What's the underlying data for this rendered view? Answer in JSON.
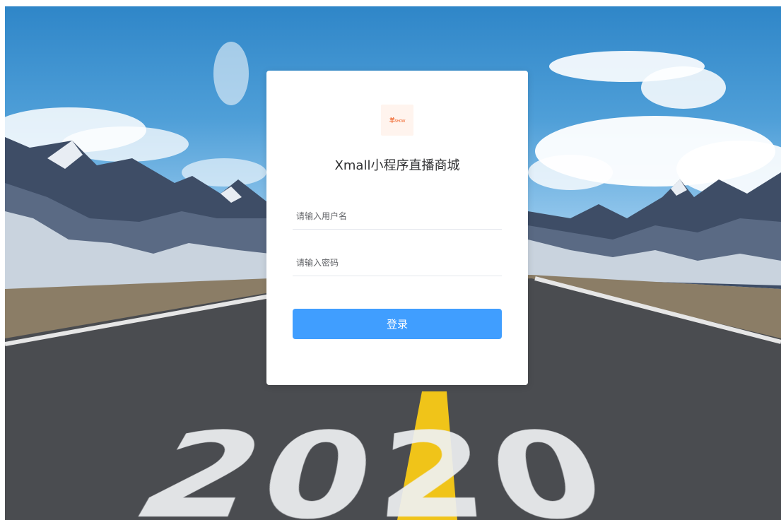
{
  "background": {
    "road_text": "2020",
    "sky_color": "#4f9fd8",
    "road_color": "#4a4c50",
    "center_line_color": "#f0c419"
  },
  "login": {
    "logo_text": "羊",
    "logo_sub": "SHOW",
    "title": "Xmall小程序直播商城",
    "username_placeholder": "请输入用户名",
    "password_placeholder": "请输入密码",
    "submit_label": "登录",
    "accent_color": "#409eff"
  }
}
